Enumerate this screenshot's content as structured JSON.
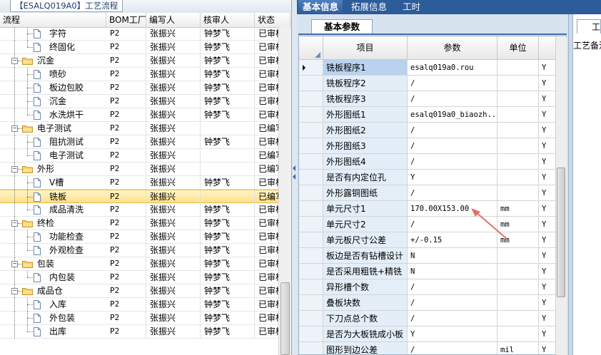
{
  "left_panel": {
    "tab_label": "【ESALQ019A0】工艺流程",
    "columns": [
      "流程",
      "BOM工厂",
      "编写人",
      "核审人",
      "状态"
    ],
    "rows": [
      {
        "name": "字符",
        "level": 2,
        "kind": "doc",
        "bom": "P2",
        "writer": "张振兴",
        "reviewer": "钟梦飞",
        "status": "已审核"
      },
      {
        "name": "终固化",
        "level": 2,
        "kind": "doc",
        "bom": "P2",
        "writer": "张振兴",
        "reviewer": "钟梦飞",
        "status": "已审核"
      },
      {
        "name": "沉金",
        "level": 1,
        "kind": "folder",
        "bom": "P2",
        "writer": "张振兴",
        "reviewer": "钟梦飞",
        "status": "已审核"
      },
      {
        "name": "喷砂",
        "level": 2,
        "kind": "doc",
        "bom": "P2",
        "writer": "张振兴",
        "reviewer": "钟梦飞",
        "status": "已审核"
      },
      {
        "name": "板边包胶",
        "level": 2,
        "kind": "doc",
        "bom": "P2",
        "writer": "张振兴",
        "reviewer": "钟梦飞",
        "status": "已审核"
      },
      {
        "name": "沉金",
        "level": 2,
        "kind": "doc",
        "bom": "P2",
        "writer": "张振兴",
        "reviewer": "钟梦飞",
        "status": "已审核"
      },
      {
        "name": "水洗烘干",
        "level": 2,
        "kind": "doc",
        "bom": "P2",
        "writer": "张振兴",
        "reviewer": "钟梦飞",
        "status": "已审核"
      },
      {
        "name": "电子测试",
        "level": 1,
        "kind": "folder",
        "bom": "P2",
        "writer": "张振兴",
        "reviewer": "",
        "status": "已编写"
      },
      {
        "name": "阻抗测试",
        "level": 2,
        "kind": "doc",
        "bom": "P2",
        "writer": "张振兴",
        "reviewer": "钟梦飞",
        "status": "已审核"
      },
      {
        "name": "电子测试",
        "level": 2,
        "kind": "doc",
        "bom": "P2",
        "writer": "张振兴",
        "reviewer": "",
        "status": "已编写"
      },
      {
        "name": "外形",
        "level": 1,
        "kind": "folder",
        "bom": "P2",
        "writer": "张振兴",
        "reviewer": "",
        "status": "已编写"
      },
      {
        "name": "V槽",
        "level": 2,
        "kind": "doc",
        "bom": "P2",
        "writer": "张振兴",
        "reviewer": "钟梦飞",
        "status": "已审核"
      },
      {
        "name": "铣板",
        "level": 2,
        "kind": "doc",
        "bom": "P2",
        "writer": "张振兴",
        "reviewer": "",
        "status": "已编写",
        "selected": true
      },
      {
        "name": "成品清洗",
        "level": 2,
        "kind": "doc",
        "bom": "P2",
        "writer": "张振兴",
        "reviewer": "钟梦飞",
        "status": "已审核"
      },
      {
        "name": "终检",
        "level": 1,
        "kind": "folder",
        "bom": "P2",
        "writer": "张振兴",
        "reviewer": "钟梦飞",
        "status": "已审核"
      },
      {
        "name": "功能检查",
        "level": 2,
        "kind": "doc",
        "bom": "P2",
        "writer": "张振兴",
        "reviewer": "钟梦飞",
        "status": "已审核"
      },
      {
        "name": "外观检查",
        "level": 2,
        "kind": "doc",
        "bom": "P2",
        "writer": "张振兴",
        "reviewer": "钟梦飞",
        "status": "已审核"
      },
      {
        "name": "包装",
        "level": 1,
        "kind": "folder",
        "bom": "P2",
        "writer": "张振兴",
        "reviewer": "钟梦飞",
        "status": "已审核"
      },
      {
        "name": "内包装",
        "level": 2,
        "kind": "doc",
        "bom": "P2",
        "writer": "张振兴",
        "reviewer": "钟梦飞",
        "status": "已审核"
      },
      {
        "name": "成品仓",
        "level": 1,
        "kind": "folder",
        "bom": "P2",
        "writer": "张振兴",
        "reviewer": "钟梦飞",
        "status": "已审核"
      },
      {
        "name": "入库",
        "level": 2,
        "kind": "doc",
        "bom": "P2",
        "writer": "张振兴",
        "reviewer": "钟梦飞",
        "status": "已审核"
      },
      {
        "name": "外包装",
        "level": 2,
        "kind": "doc",
        "bom": "P2",
        "writer": "张振兴",
        "reviewer": "钟梦飞",
        "status": "已审核"
      },
      {
        "name": "出库",
        "level": 2,
        "kind": "doc",
        "bom": "P2",
        "writer": "张振兴",
        "reviewer": "钟梦飞",
        "status": "已审核"
      }
    ]
  },
  "right_panel": {
    "top_tabs": [
      {
        "label": "基本信息",
        "active": true
      },
      {
        "label": "拓展信息",
        "active": false
      },
      {
        "label": "工时",
        "active": false
      }
    ],
    "sub_tab": "基本参数",
    "columns": [
      "项目",
      "参数",
      "单位"
    ],
    "rows": [
      {
        "item": "铣板程序1",
        "param": "esalq019a0.rou",
        "unit": "",
        "flag": "Y",
        "current": true
      },
      {
        "item": "铣板程序2",
        "param": "/",
        "unit": "",
        "flag": "Y"
      },
      {
        "item": "铣板程序3",
        "param": "/",
        "unit": "",
        "flag": "Y"
      },
      {
        "item": "外形图纸1",
        "param": "esalq019a0_biaozh...",
        "unit": "",
        "flag": "Y"
      },
      {
        "item": "外形图纸2",
        "param": "/",
        "unit": "",
        "flag": "Y"
      },
      {
        "item": "外形图纸3",
        "param": "/",
        "unit": "",
        "flag": "Y"
      },
      {
        "item": "外形图纸4",
        "param": "/",
        "unit": "",
        "flag": "Y"
      },
      {
        "item": "是否有内定位孔",
        "param": "Y",
        "unit": "",
        "flag": "Y"
      },
      {
        "item": "外形露铜图纸",
        "param": "/",
        "unit": "",
        "flag": "Y"
      },
      {
        "item": "单元尺寸1",
        "param": "170.00X153.00",
        "unit": "mm",
        "flag": "Y"
      },
      {
        "item": "单元尺寸2",
        "param": "/",
        "unit": "mm",
        "flag": "Y"
      },
      {
        "item": "单元板尺寸公差",
        "param": "+/-0.15",
        "unit": "mm",
        "flag": "Y"
      },
      {
        "item": "板边是否有钻槽设计",
        "param": "N",
        "unit": "",
        "flag": "Y"
      },
      {
        "item": "是否采用粗铣+精铣",
        "param": "N",
        "unit": "",
        "flag": "Y"
      },
      {
        "item": "异形槽个数",
        "param": "/",
        "unit": "",
        "flag": "Y"
      },
      {
        "item": "叠板块数",
        "param": "/",
        "unit": "",
        "flag": "Y"
      },
      {
        "item": "下刀点总个数",
        "param": "/",
        "unit": "",
        "flag": "Y"
      },
      {
        "item": "是否为大板铣成小板",
        "param": "Y",
        "unit": "",
        "flag": "Y"
      },
      {
        "item": "图形到边公差",
        "param": "/",
        "unit": "mil",
        "flag": "Y"
      }
    ],
    "far_right_tab": "工",
    "far_right_label": "工艺备注"
  },
  "colors": {
    "top_bar": "#2c5c9a",
    "selected_row": "#ffe08a",
    "label_cell": "#e4eef8",
    "annotation_arrow": "#e0706a"
  }
}
